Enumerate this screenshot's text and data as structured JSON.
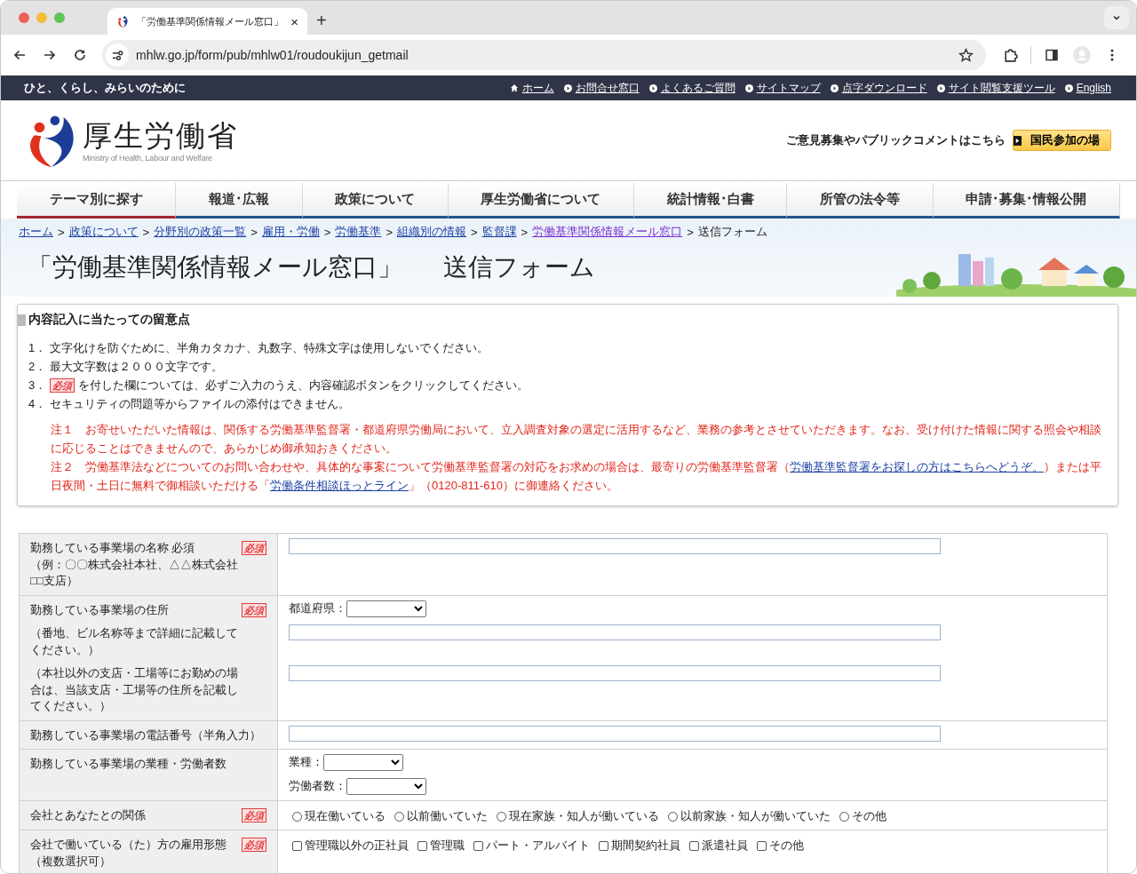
{
  "browser": {
    "tab_title": "「労働基準関係情報メール窓口」",
    "close": "×",
    "new_tab": "+",
    "url": "mhlw.go.jp/form/pub/mhlw01/roudoukijun_getmail"
  },
  "site_bar": {
    "tagline": "ひと、くらし、みらいのために",
    "links": [
      {
        "label": "ホーム",
        "kind": "home"
      },
      {
        "label": "お問合せ窓口",
        "kind": "link"
      },
      {
        "label": "よくあるご質問",
        "kind": "link"
      },
      {
        "label": "サイトマップ",
        "kind": "link"
      },
      {
        "label": "点字ダウンロード",
        "kind": "link"
      },
      {
        "label": "サイト閲覧支援ツール",
        "kind": "link"
      },
      {
        "label": "English",
        "kind": "link"
      }
    ]
  },
  "header": {
    "logo_text": "厚生労働省",
    "logo_sub": "Ministry of Health, Labour and Welfare",
    "participation_text": "ご意見募集やパブリックコメントはこちら",
    "participation_button": "国民参加の場"
  },
  "nav": [
    {
      "label": "テーマ別に探す",
      "selected": true
    },
    {
      "label": "報道･広報",
      "selected": false
    },
    {
      "label": "政策について",
      "selected": false
    },
    {
      "label": "厚生労働省について",
      "selected": false
    },
    {
      "label": "統計情報･白書",
      "selected": false
    },
    {
      "label": "所管の法令等",
      "selected": false
    },
    {
      "label": "申請･募集･情報公開",
      "selected": false
    }
  ],
  "breadcrumb": {
    "links": [
      {
        "label": "ホーム",
        "visited": false
      },
      {
        "label": "政策について",
        "visited": false
      },
      {
        "label": "分野別の政策一覧",
        "visited": false
      },
      {
        "label": "雇用・労働",
        "visited": false
      },
      {
        "label": "労働基準",
        "visited": false
      },
      {
        "label": "組織別の情報",
        "visited": false
      },
      {
        "label": "監督課",
        "visited": false
      },
      {
        "label": "労働基準関係情報メール窓口",
        "visited": true
      }
    ],
    "separator": ">",
    "current": "送信フォーム"
  },
  "page_title": [
    "「労働基準関係情報メール窓口」",
    "送信フォーム"
  ],
  "notice": {
    "heading": "内容記入に当たっての留意点",
    "items": [
      {
        "number": "1．",
        "text": "文字化けを防ぐために、半角カタカナ、丸数字、特殊文字は使用しないでください。"
      },
      {
        "number": "2．",
        "text": "最大文字数は２０００文字です。"
      },
      {
        "number": "3．",
        "badge": "必須",
        "text": "を付した欄については、必ずご入力のうえ、内容確認ボタンをクリックしてください。"
      },
      {
        "number": "4．",
        "text": "セキュリティの問題等からファイルの添付はできません。"
      }
    ],
    "notes": [
      [
        {
          "kind": "text",
          "text": "注１　お寄せいただいた情報は、関係する労働基準監督署・都道府県労働局において、立入調査対象の選定に活用するなど、業務の参考とさせていただきます。なお、受け付けた情報に関する照会や相談に応じることはできませんので、あらかじめ御承知おきください。"
        }
      ],
      [
        {
          "kind": "text",
          "text": "注２　労働基準法などについてのお問い合わせや、具体的な事案について労働基準監督署の対応をお求めの場合は、最寄りの労働基準監督署（"
        },
        {
          "kind": "link",
          "text": "労働基準監督署をお探しの方はこちらへどうぞ。"
        },
        {
          "kind": "text",
          "text": "）または平日夜間・土日に無料で御相談いただける「"
        },
        {
          "kind": "link",
          "text": "労働条件相談ほっとライン"
        },
        {
          "kind": "text",
          "text": "」（0120-811-610）に御連絡ください。"
        }
      ]
    ]
  },
  "form": {
    "rows": [
      {
        "label_lines": [
          "勤務している事業場の名称 必須",
          "（例：〇〇株式会社本社、△△株式会社□□支店）"
        ],
        "badge": "必須",
        "fields": [
          {
            "kind": "text"
          }
        ]
      },
      {
        "label_lines": [
          "勤務している事業場の住所",
          "（番地、ビル名称等まで詳細に記載してください。）",
          "（本社以外の支店・工場等にお勤めの場合は、当該支店・工場等の住所を記載してください。）"
        ],
        "badge": "必須",
        "fields": [
          {
            "kind": "select",
            "label": "都道府県："
          },
          {
            "kind": "text"
          },
          {
            "kind": "text"
          }
        ]
      },
      {
        "label_lines": [
          "勤務している事業場の電話番号（半角入力）"
        ],
        "fields": [
          {
            "kind": "text"
          }
        ]
      },
      {
        "label_lines": [
          "勤務している事業場の業種・労働者数"
        ],
        "fields": [
          {
            "kind": "select",
            "label": "業種："
          },
          {
            "kind": "select",
            "label": "労働者数："
          }
        ]
      },
      {
        "label_lines": [
          "会社とあなたとの関係"
        ],
        "badge": "必須",
        "fields": [
          {
            "kind": "radios",
            "options": [
              {
                "label": "現在働いている",
                "selected": false
              },
              {
                "label": "以前働いていた",
                "selected": false
              },
              {
                "label": "現在家族・知人が働いている",
                "selected": false
              },
              {
                "label": "以前家族・知人が働いていた",
                "selected": false
              },
              {
                "label": "その他",
                "selected": false
              }
            ]
          }
        ]
      },
      {
        "label_lines": [
          "会社で働いている（た）方の雇用形態",
          "（複数選択可）"
        ],
        "badge": "必須",
        "fields": [
          {
            "kind": "checkboxes",
            "options": [
              {
                "label": "管理職以外の正社員",
                "checked": false
              },
              {
                "label": "管理職",
                "checked": false
              },
              {
                "label": "パート・アルバイト",
                "checked": false
              },
              {
                "label": "期間契約社員",
                "checked": false
              },
              {
                "label": "派遣社員",
                "checked": false
              },
              {
                "label": "その他",
                "checked": false
              }
            ]
          }
        ]
      }
    ]
  }
}
